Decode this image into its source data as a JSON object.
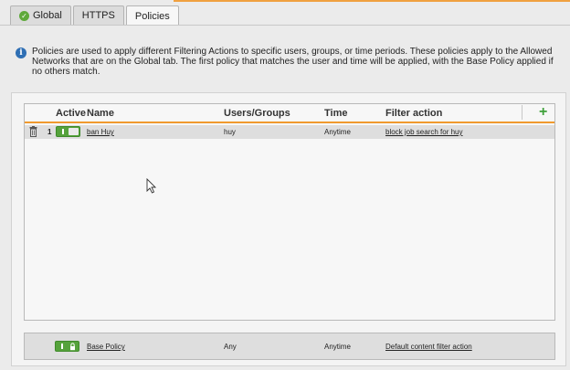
{
  "tabs": [
    {
      "label": "Global",
      "status": "ok"
    },
    {
      "label": "HTTPS"
    },
    {
      "label": "Policies",
      "active": true
    }
  ],
  "info": {
    "text": "Policies are used to apply different Filtering Actions to specific users, groups, or time periods. These policies apply to the Allowed Networks that are on the Global tab. The first policy that matches the user and time will be applied, with the Base Policy applied if no others match."
  },
  "table": {
    "columns": {
      "active": "Active",
      "name": "Name",
      "users": "Users/Groups",
      "time": "Time",
      "filter": "Filter action"
    },
    "rows": [
      {
        "index": "1",
        "active": true,
        "name": "ban Huy",
        "users": "huy",
        "time": "Anytime",
        "filter": "block job search for huy"
      }
    ]
  },
  "base_policy": {
    "active": true,
    "locked": true,
    "name": "Base Policy",
    "users": "Any",
    "time": "Anytime",
    "filter": "Default content filter action"
  },
  "colors": {
    "accent": "#f09a2e",
    "toggle_on": "#55a23b",
    "add": "#3ea03a",
    "info": "#2f6fb4"
  },
  "icons": [
    "check-circle-icon",
    "info-icon",
    "add-icon",
    "trash-icon",
    "lock-icon",
    "mouse-pointer-icon"
  ]
}
